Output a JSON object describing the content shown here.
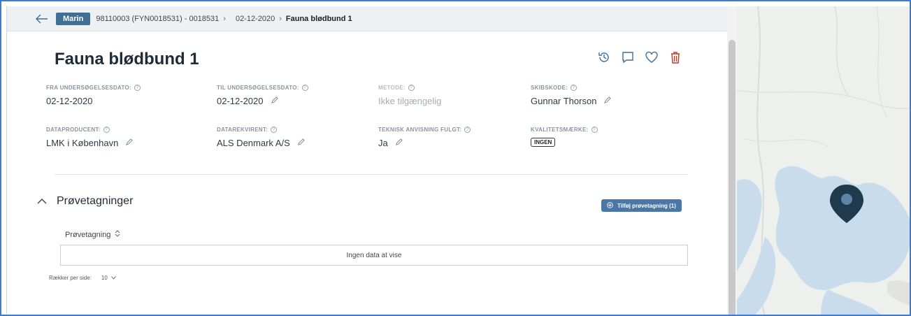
{
  "breadcrumb": {
    "badge": "Marin",
    "path": "98110003 (FYN0018531) - 0018531",
    "date": "02-12-2020",
    "current": "Fauna blødbund 1"
  },
  "page": {
    "title": "Fauna blødbund 1",
    "icons": [
      "history-icon",
      "comment-icon",
      "heart-icon",
      "trash-icon"
    ]
  },
  "fields": {
    "fra_label": "FRA UNDERSØGELSESDATO:",
    "fra_value": "02-12-2020",
    "til_label": "TIL UNDERSØGELSESDATO:",
    "til_value": "02-12-2020",
    "metode_label": "METODE:",
    "metode_value": "Ikke tilgængelig",
    "skibskode_label": "SKIBSKODE:",
    "skibskode_value": "Gunnar Thorson",
    "dataproducent_label": "DATAPRODUCENT:",
    "dataproducent_value": "LMK i København",
    "datarekvirent_label": "DATAREKVIRENT:",
    "datarekvirent_value": "ALS Denmark A/S",
    "teknisk_label": "TEKNISK ANVISNING FULGT:",
    "teknisk_value": "Ja",
    "kvalitet_label": "KVALITETSMÆRKE:",
    "kvalitet_value": "INGEN"
  },
  "section": {
    "title": "Prøvetagninger",
    "add_button": "Tilføj prøvetagning (1)",
    "column_header": "Prøvetagning",
    "empty_message": "Ingen data at vise",
    "rows_per_page_label": "Rækker per side:",
    "rows_per_page_value": "10"
  },
  "colors": {
    "accent": "#3f6f95",
    "button": "#4a77a8",
    "delete": "#c0392b",
    "map_water": "#c9dceb",
    "map_pin": "#1f3a4d"
  }
}
